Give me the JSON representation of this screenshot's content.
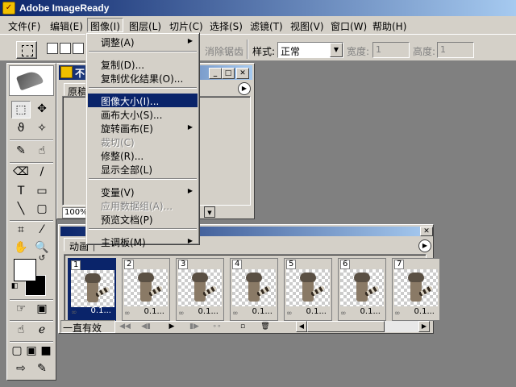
{
  "window": {
    "title": "Adobe ImageReady"
  },
  "menubar": {
    "items": [
      "文件(F)",
      "编辑(E)",
      "图像(I)",
      "图层(L)",
      "切片(C)",
      "选择(S)",
      "滤镜(T)",
      "视图(V)",
      "窗口(W)",
      "帮助(H)"
    ],
    "active_index": 2
  },
  "options_bar": {
    "antialias_label": "消除锯齿",
    "style_label": "样式:",
    "style_value": "正常",
    "width_label": "宽度:",
    "width_value": "1",
    "height_label": "高度:",
    "height_value": "1"
  },
  "image_menu": {
    "groups": [
      [
        {
          "label": "调整(A)",
          "submenu": true
        }
      ],
      [
        {
          "label": "复制(D)..."
        },
        {
          "label": "复制优化结果(O)..."
        }
      ],
      [
        {
          "label": "图像大小(I)...",
          "highlighted": true
        },
        {
          "label": "画布大小(S)..."
        },
        {
          "label": "旋转画布(E)",
          "submenu": true
        },
        {
          "label": "裁切(C)",
          "disabled": true
        },
        {
          "label": "修整(R)..."
        },
        {
          "label": "显示全部(L)"
        }
      ],
      [
        {
          "label": "变量(V)",
          "submenu": true
        },
        {
          "label": "应用数据组(A)...",
          "disabled": true
        },
        {
          "label": "预览文档(P)"
        }
      ],
      [
        {
          "label": "主调板(M)",
          "submenu": true
        }
      ]
    ]
  },
  "document_window": {
    "title": "不",
    "tab": "原稿",
    "zoom": "100%"
  },
  "animation_palette": {
    "tab": "动画",
    "loop": "一直有效",
    "frames": [
      {
        "num": "1",
        "delay": "0.1...",
        "selected": true
      },
      {
        "num": "2",
        "delay": "0.1..."
      },
      {
        "num": "3",
        "delay": "0.1..."
      },
      {
        "num": "4",
        "delay": "0.1..."
      },
      {
        "num": "5",
        "delay": "0.1..."
      },
      {
        "num": "6",
        "delay": "0.1..."
      },
      {
        "num": "7",
        "delay": "0.1..."
      }
    ]
  },
  "colors": {
    "titlebar": "#0a246a",
    "chrome": "#d4d0c8",
    "workspace": "#808080"
  }
}
